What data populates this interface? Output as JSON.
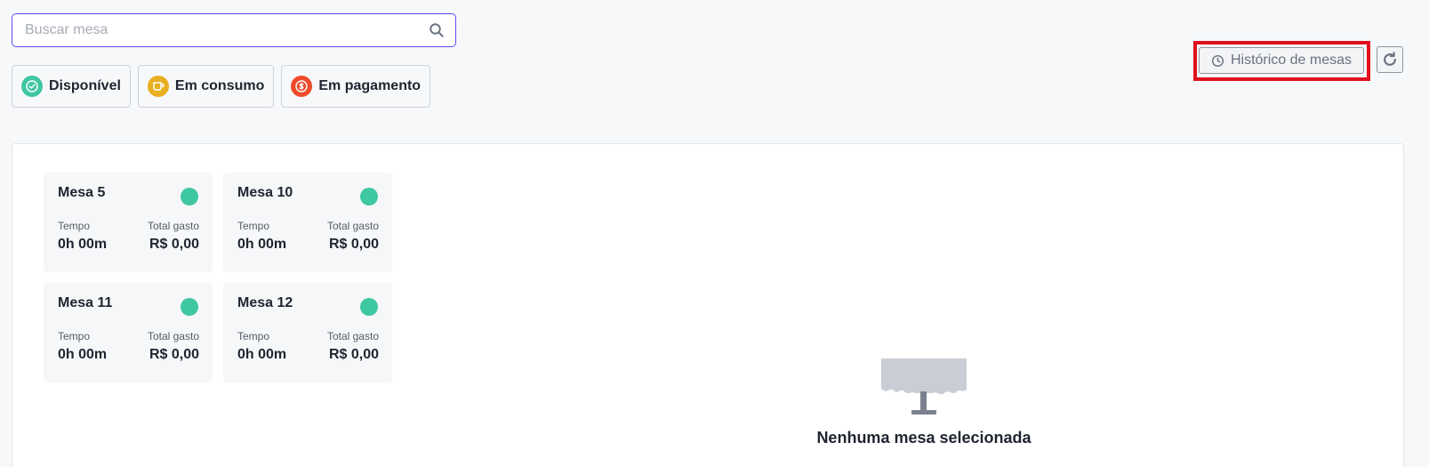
{
  "search": {
    "placeholder": "Buscar mesa",
    "value": ""
  },
  "filters": [
    {
      "label": "Disponível",
      "color": "#3fc7a2",
      "icon": "check-circle-icon"
    },
    {
      "label": "Em consumo",
      "color": "#e8b020",
      "icon": "cup-icon"
    },
    {
      "label": "Em pagamento",
      "color": "#ee4b2b",
      "icon": "money-icon"
    }
  ],
  "header": {
    "history_label": "Histórico de mesas"
  },
  "tables": [
    {
      "name": "Mesa 5",
      "time_label": "Tempo",
      "time": "0h 00m",
      "total_label": "Total gasto",
      "total": "R$ 0,00",
      "status_color": "#3fc7a2"
    },
    {
      "name": "Mesa 10",
      "time_label": "Tempo",
      "time": "0h 00m",
      "total_label": "Total gasto",
      "total": "R$ 0,00",
      "status_color": "#3fc7a2"
    },
    {
      "name": "Mesa 11",
      "time_label": "Tempo",
      "time": "0h 00m",
      "total_label": "Total gasto",
      "total": "R$ 0,00",
      "status_color": "#3fc7a2"
    },
    {
      "name": "Mesa 12",
      "time_label": "Tempo",
      "time": "0h 00m",
      "total_label": "Total gasto",
      "total": "R$ 0,00",
      "status_color": "#3fc7a2"
    }
  ],
  "empty_state": {
    "title": "Nenhuma mesa selecionada"
  },
  "colors": {
    "accent": "#5b4bf5",
    "highlight": "#e0101e"
  }
}
